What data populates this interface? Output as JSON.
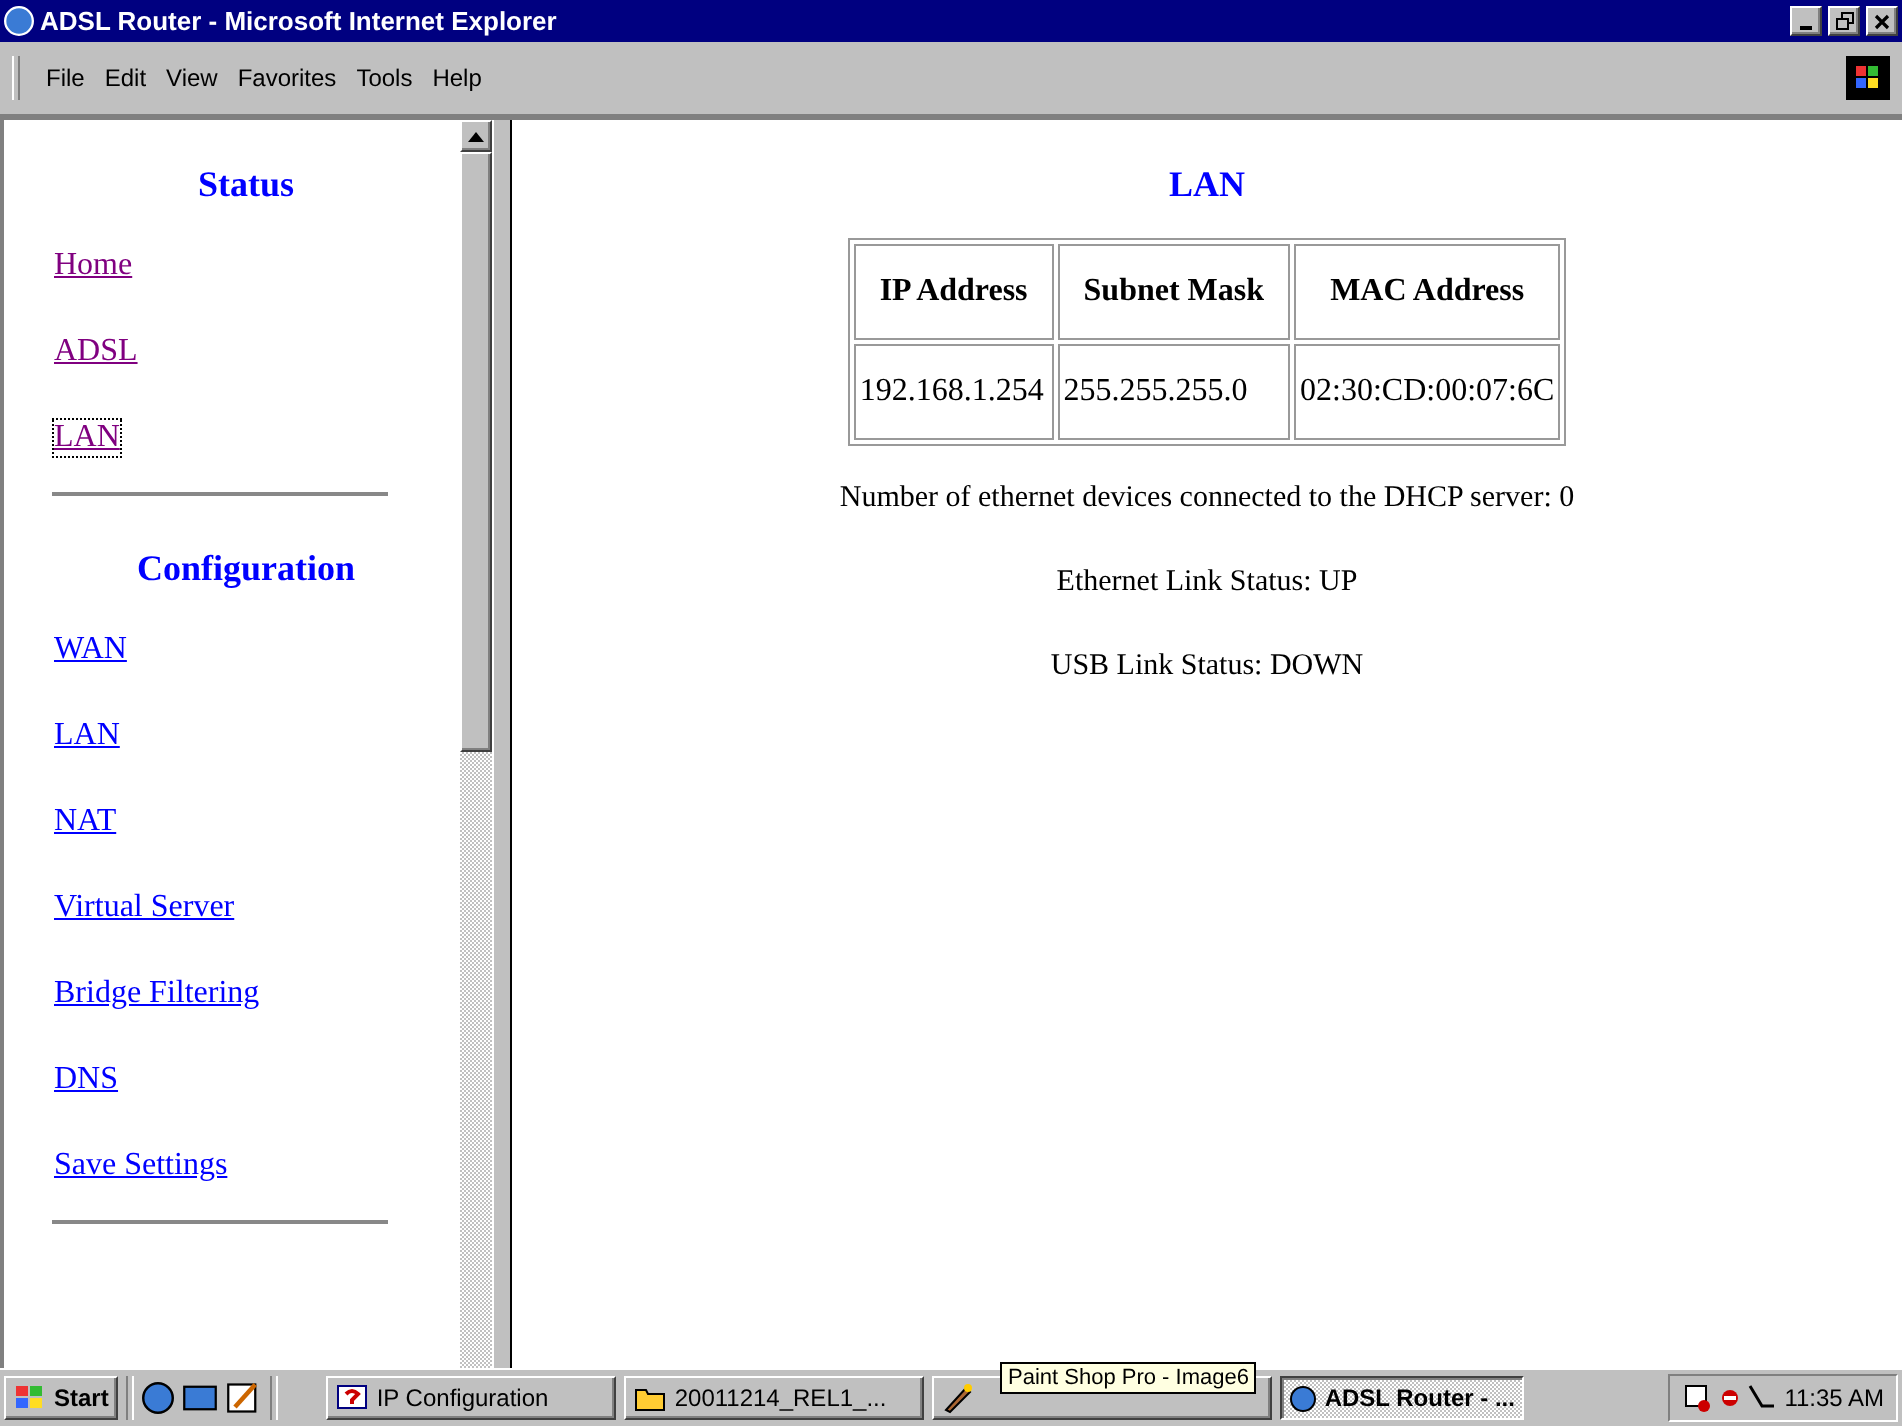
{
  "window": {
    "title": "ADSL Router - Microsoft Internet Explorer"
  },
  "menu": [
    "File",
    "Edit",
    "View",
    "Favorites",
    "Tools",
    "Help"
  ],
  "sidebar": {
    "sections": [
      {
        "heading": "Status",
        "items": [
          {
            "label": "Home",
            "visited": true,
            "focused": false
          },
          {
            "label": "ADSL",
            "visited": true,
            "focused": false
          },
          {
            "label": "LAN",
            "visited": true,
            "focused": true
          }
        ]
      },
      {
        "heading": "Configuration",
        "items": [
          {
            "label": "WAN",
            "visited": false,
            "focused": false
          },
          {
            "label": "LAN",
            "visited": false,
            "focused": false
          },
          {
            "label": "NAT",
            "visited": false,
            "focused": false
          },
          {
            "label": "Virtual Server",
            "visited": false,
            "focused": false
          },
          {
            "label": "Bridge Filtering",
            "visited": false,
            "focused": false
          },
          {
            "label": "DNS",
            "visited": false,
            "focused": false
          },
          {
            "label": "Save Settings",
            "visited": false,
            "focused": false
          }
        ]
      }
    ]
  },
  "content": {
    "title": "LAN",
    "table": {
      "columns": [
        "IP Address",
        "Subnet Mask",
        "MAC Address"
      ],
      "rows": [
        [
          "192.168.1.254",
          "255.255.255.0",
          "02:30:CD:00:07:6C"
        ]
      ]
    },
    "lines": [
      "Number of ethernet devices connected to the DHCP server: 0",
      "Ethernet Link Status: UP",
      "USB Link Status: DOWN"
    ]
  },
  "taskbar": {
    "start": "Start",
    "tasks": [
      {
        "label": "IP Configuration",
        "kind": "help",
        "selected": false
      },
      {
        "label": "20011214_REL1_...",
        "kind": "folder",
        "selected": false
      },
      {
        "kind": "paint",
        "selected": false
      },
      {
        "label": "ADSL Router - ...",
        "kind": "ie",
        "selected": true
      }
    ],
    "tooltip": "Paint Shop Pro - Image6",
    "clock": "11:35 AM"
  }
}
